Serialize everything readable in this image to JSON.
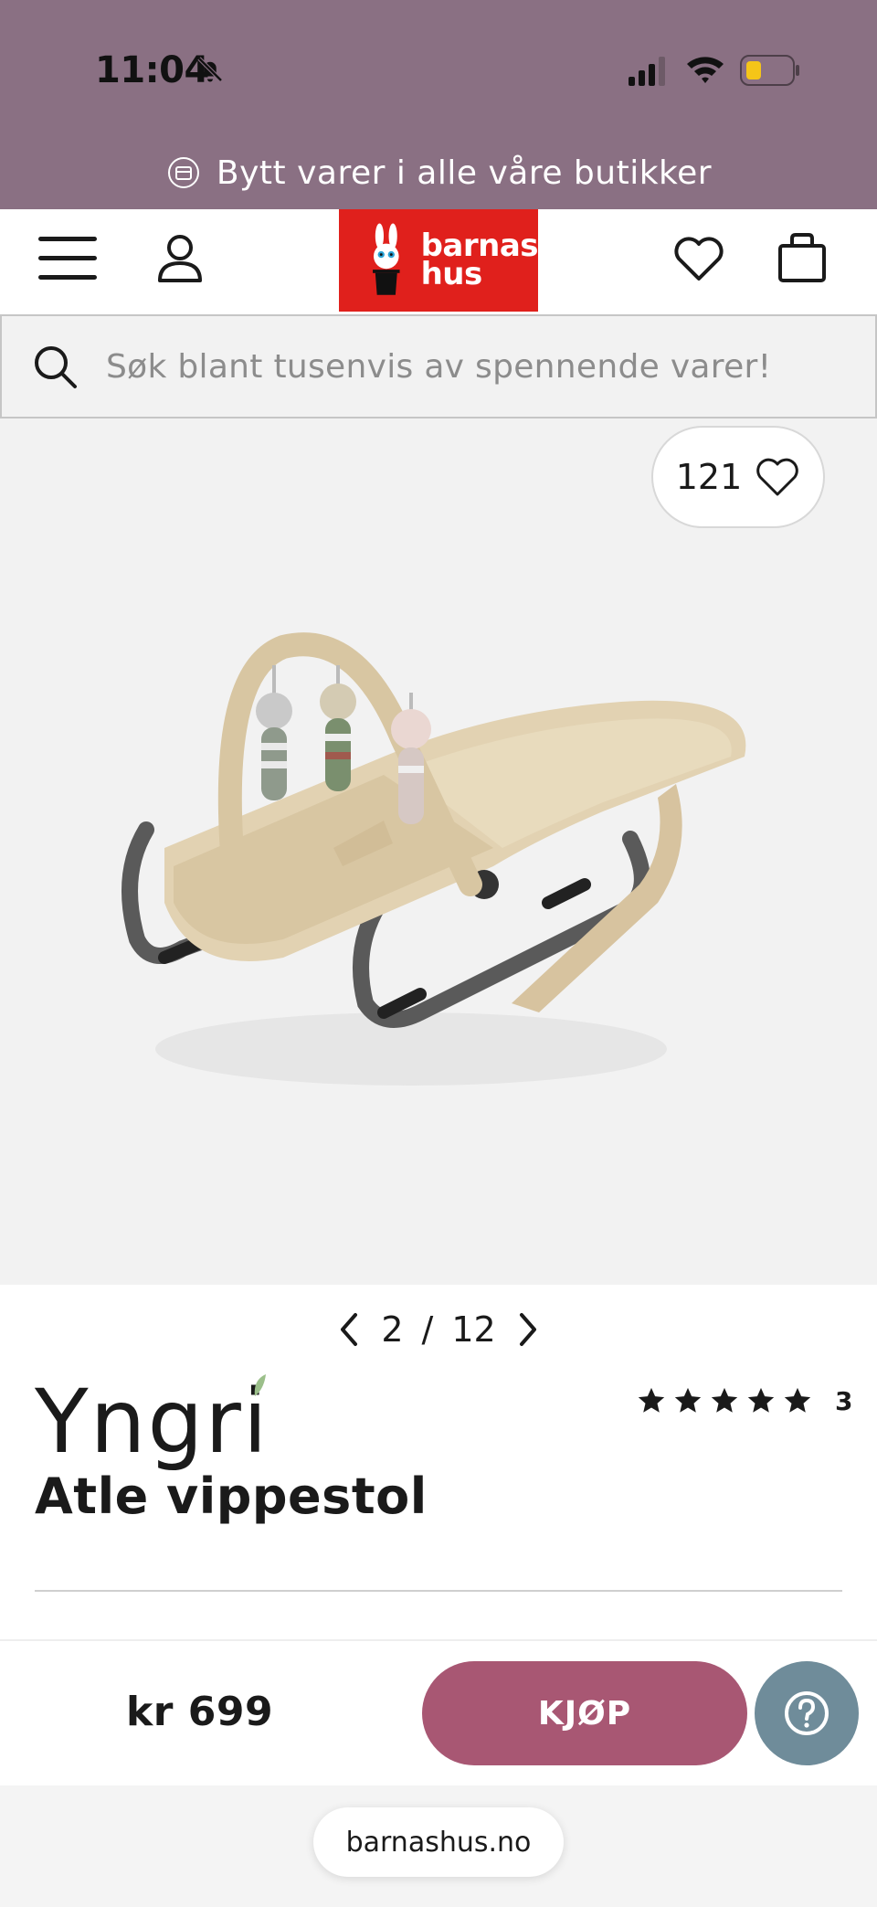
{
  "status_bar": {
    "time": "11:04",
    "bell_icon": "bell-slash-icon",
    "signal_icon": "cellular-signal-icon",
    "wifi_icon": "wifi-icon",
    "battery_icon": "battery-low-icon"
  },
  "promo": {
    "text": "Bytt varer i alle våre butikker",
    "icon": "exchange-box-icon",
    "background": "#8a7083"
  },
  "header": {
    "menu_icon": "hamburger-menu-icon",
    "account_icon": "account-icon",
    "logo_text_line1": "barnas",
    "logo_text_line2": "hus",
    "logo_color": "#e0201c",
    "wishlist_icon": "heart-icon",
    "cart_icon": "shopping-bag-icon"
  },
  "search": {
    "placeholder": "Søk blant tusenvis av spennende varer!",
    "icon": "search-icon"
  },
  "product": {
    "favorites_count": "121",
    "image_index": "2",
    "image_total": "12",
    "image_separator": "/",
    "brand": "Yngri",
    "title": "Atle vippestol",
    "rating_stars": 5,
    "rating_count": "3",
    "price": "kr 699"
  },
  "actions": {
    "buy_label": "KJØP",
    "buy_color": "#a85773",
    "help_icon": "question-mark-icon",
    "help_color": "#6f8c9a"
  },
  "browser": {
    "url": "barnashus.no"
  }
}
